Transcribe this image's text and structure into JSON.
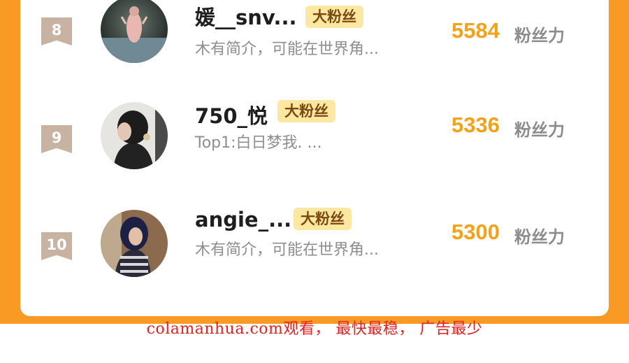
{
  "fan_rank_list": {
    "items": [
      {
        "rank": "8",
        "name": "媛__snv...",
        "badge": "大粉丝",
        "intro": "木有简介，可能在世界角...",
        "score": "5584",
        "unit": "粉丝力"
      },
      {
        "rank": "9",
        "name": "750_悦",
        "badge": "大粉丝",
        "intro": "Top1:白日梦我. ...",
        "score": "5336",
        "unit": "粉丝力"
      },
      {
        "rank": "10",
        "name": "angie_...",
        "badge": "大粉丝",
        "intro": "木有简介，可能在世界角...",
        "score": "5300",
        "unit": "粉丝力"
      }
    ]
  },
  "footer": {
    "watermark_text": "colamanhua.com观看， 最快最稳， 广告最少"
  },
  "colors": {
    "background_orange": "#f89a23",
    "score_orange": "#f5a21a",
    "badge_bg": "#fde7a1",
    "rank_tag": "#c8b3a2",
    "watermark_red": "#e32222"
  }
}
